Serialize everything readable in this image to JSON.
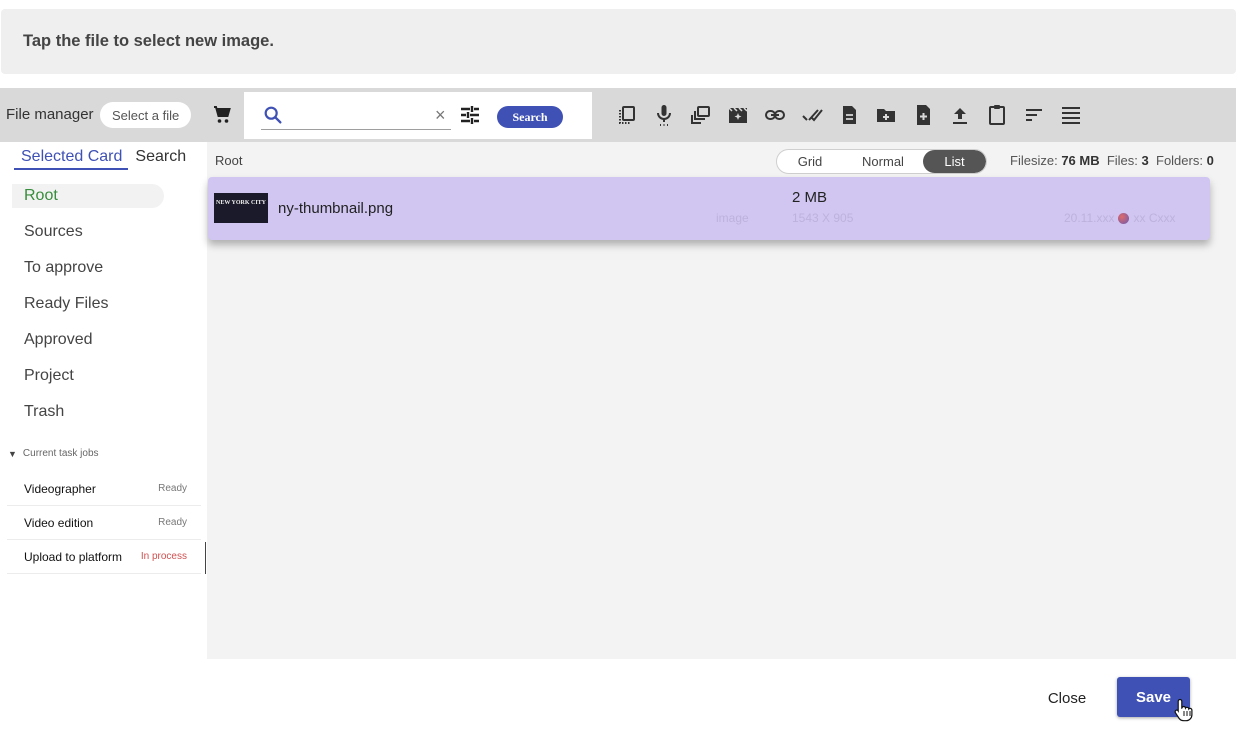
{
  "banner": {
    "text": "Tap the file to select new image."
  },
  "toolbar": {
    "title": "File manager",
    "select_file": "Select a file",
    "search": {
      "value": "",
      "placeholder": "",
      "clear": "×",
      "button": "Search"
    },
    "icons": [
      "selection-icon",
      "microphone-icon",
      "gallery-icon",
      "movie-edit-icon",
      "link-icon",
      "done-all-icon",
      "document-icon",
      "new-folder-icon",
      "new-file-icon",
      "upload-icon",
      "clipboard-icon",
      "sort-icon",
      "list-view-icon"
    ]
  },
  "sidebar": {
    "tabs": [
      {
        "label": "Selected Card",
        "active": true
      },
      {
        "label": "Search",
        "active": false
      }
    ],
    "folders": [
      "Root",
      "Sources",
      "To approve",
      "Ready Files",
      "Approved",
      "Project",
      "Trash"
    ],
    "tasks_header": "Current task jobs",
    "tasks": [
      {
        "name": "Videographer",
        "status": "Ready"
      },
      {
        "name": "Video edition",
        "status": "Ready"
      },
      {
        "name": "Upload to platform",
        "status": "In process"
      }
    ]
  },
  "main": {
    "breadcrumb": "Root",
    "views": [
      "Grid",
      "Normal",
      "List"
    ],
    "active_view": "List",
    "stats": {
      "filesize_label": "Filesize:",
      "filesize": "76 MB",
      "files_label": "Files:",
      "files": "3",
      "folders_label": "Folders:",
      "folders": "0"
    },
    "files": [
      {
        "thumb_text": "NEW YORK CITY",
        "name": "ny-thumbnail.png",
        "type": "image",
        "size": "2 MB",
        "dimensions": "1543 X 905",
        "date": "20.11.xxx",
        "owner": "xx Cxxx"
      }
    ]
  },
  "footer": {
    "close": "Close",
    "save": "Save"
  },
  "colors": {
    "accent": "#3f51b5",
    "selected_row": "#d1c6f2",
    "active_folder": "#388e3c",
    "in_process": "#d05050"
  }
}
